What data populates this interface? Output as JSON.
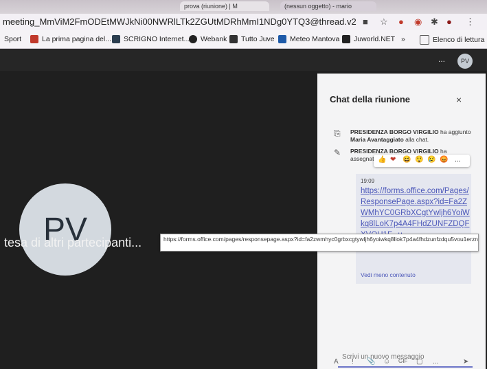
{
  "browser": {
    "tabs": [
      "prova (riunione) | M",
      "(nessun oggetto) - mario"
    ],
    "url": "meeting_MmViM2FmODEtMWJkNi00NWRlLTk2ZGUtMDRhMmI1NDg0YTQ3@thread.v2",
    "bookmarks": [
      {
        "label": "Sport",
        "color": "#ffffff"
      },
      {
        "label": "La prima pagina del...",
        "color": "#c0392b"
      },
      {
        "label": "SCRIGNO Internet...",
        "color": "#2c3e50"
      },
      {
        "label": "Webank",
        "color": "#222222"
      },
      {
        "label": "Tutto Juve",
        "color": "#333333"
      },
      {
        "label": "Meteo Mantova",
        "color": "#1e5aa8"
      },
      {
        "label": "Juworld.NET",
        "color": "#222222"
      }
    ],
    "bookmarks_more": "»",
    "reading_list": "Elenco di lettura"
  },
  "meeting": {
    "participant_initials": "PV",
    "waiting_text": "tesa di altri partecipanti...",
    "user_initials": "PV",
    "more": "..."
  },
  "chat": {
    "title": "Chat della riunione",
    "close": "×",
    "event1": {
      "actor": "PRESIDENZA BORGO VIRGILIO",
      "text1": " ha aggiunto ",
      "subject": "Maria Avantaggiato",
      "text2": " alla chat."
    },
    "event2": {
      "actor": "PRESIDENZA BORGO VIRGILIO",
      "text": " ha assegnato"
    },
    "message": {
      "time": "19:09",
      "link": "https://forms.office.com/Pages/ResponsePage.aspx?id=Fa2ZWMhYC0GRbXCgtYwljh6YoiWkq8lLoK7p4A4FHdZUNFZDQFXVOU1F...u",
      "show_less": "Vedi meno contenuto"
    },
    "reactions": [
      "👍",
      "❤",
      "😆",
      "😲",
      "😢",
      "😡",
      "..."
    ],
    "compose_placeholder": "Scrivi un nuovo messaggio",
    "tools": [
      "A",
      "!",
      "📎",
      "☺",
      "GIF",
      "▢",
      "...",
      "➤"
    ]
  },
  "tooltip": "https://forms.office.com/pages/responsepage.aspx?id=fa2zwmhyc0grbxcgtywljh6yoiwkq8llok7p4a4fhdzunfzdqu5vou1erznaofdhofa3qljqmthmws4u",
  "colors": {
    "accent": "#4b57b9",
    "stage": "#1f1f1f",
    "panel": "#f4f4f5"
  }
}
